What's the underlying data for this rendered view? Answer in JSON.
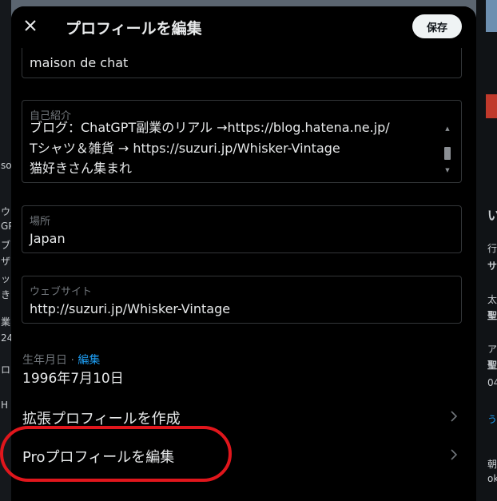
{
  "header": {
    "title": "プロフィールを編集",
    "save_label": "保存"
  },
  "fields": {
    "name": {
      "value": "maison de chat"
    },
    "bio": {
      "label": "自己紹介",
      "lines": [
        "ブログ：ChatGPT副業のリアル →https://blog.hatena.ne.jp/",
        "Tシャツ＆雑貨 → https://suzuri.jp/Whisker-Vintage",
        "猫好きさん集まれ"
      ]
    },
    "location": {
      "label": "場所",
      "value": "Japan"
    },
    "website": {
      "label": "ウェブサイト",
      "value": "http://suzuri.jp/Whisker-Vintage"
    }
  },
  "birthdate": {
    "label": "生年月日 · ",
    "edit_label": "編集",
    "value": "1996年7月10日"
  },
  "menu": {
    "extended_profile": "拡張プロフィールを作成",
    "pro_profile": "Proプロフィールを編集"
  },
  "background_fragments": {
    "left": [
      "so",
      "ウ",
      "GP",
      "ブ",
      "ザ",
      "ッ",
      "き",
      "業",
      "24",
      "ロ",
      "H"
    ],
    "right": [
      "い",
      "行",
      "サ",
      "太",
      "聖",
      "ア",
      "聖",
      "04",
      "う",
      "朝",
      "ok"
    ]
  },
  "colors": {
    "accent_blue": "#1d9bf0",
    "highlight_red": "#e0161c",
    "modal_bg": "#000000",
    "border": "#333639"
  },
  "icons": {
    "close": "close-icon",
    "chevron": "chevron-right-icon"
  }
}
